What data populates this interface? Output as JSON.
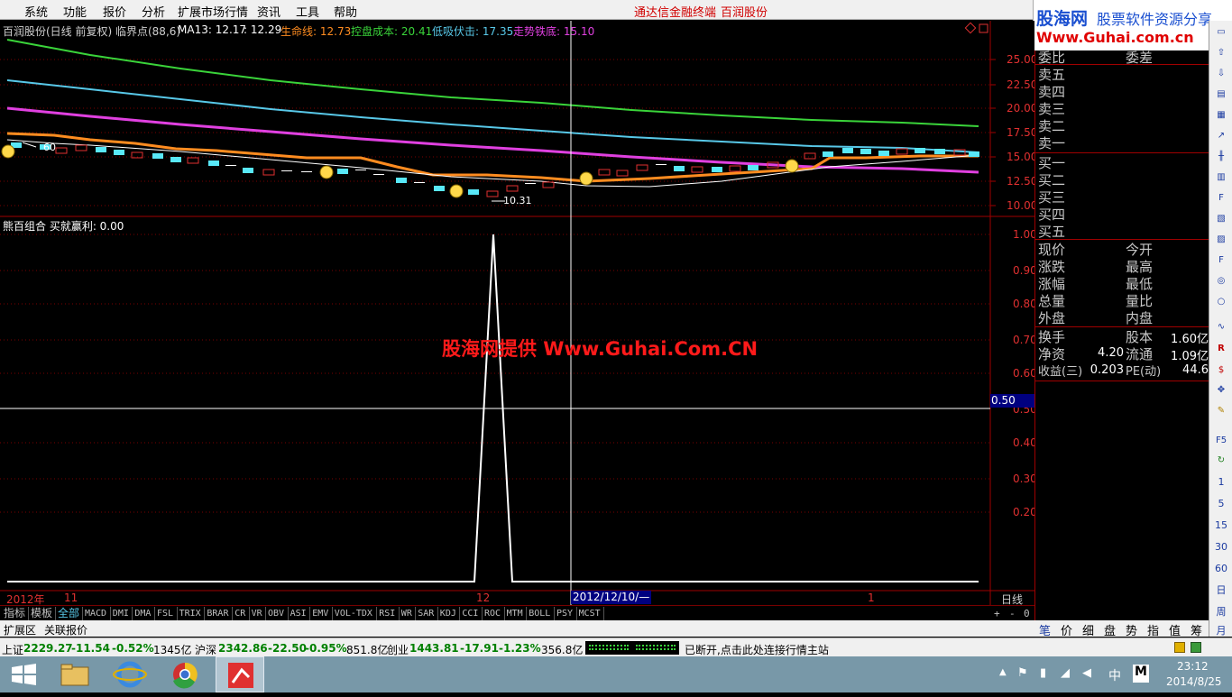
{
  "menu": {
    "items": [
      "系统",
      "功能",
      "报价",
      "分析",
      "扩展市场行情",
      "资讯",
      "工具",
      "帮助"
    ],
    "center_title": "通达信金融终端",
    "center_stock": "百润股份"
  },
  "logo": {
    "line1a": "股海网",
    "line1b": "股票软件资源分享",
    "line2": "Www.Guhai.com.cn"
  },
  "main_chart": {
    "title": "百润股份(日线 前复权) 临界点(88,6)",
    "ma13": "MA13: 12.17",
    "ma13b": ": 12.29",
    "l1": "生命线: 12.73",
    "l2": "控盘成本: 20.41",
    "l3": "低吸伏击: 17.35",
    "l4": "走势铁底: 15.10",
    "y_ticks": [
      "25.00",
      "22.50",
      "20.00",
      "17.50",
      "15.00",
      "12.50",
      "10.00"
    ],
    "high_label": "60",
    "low_label": "10.31",
    "colors": {
      "green": "#3ad43a",
      "cyan": "#58c8e8",
      "magenta": "#e040e0",
      "orange": "#ff8c20",
      "white": "#ffffff",
      "red": "#e03030"
    }
  },
  "sub_chart": {
    "title": "熊百组合  买就赢利: 0.00",
    "y_ticks": [
      "1.00",
      "0.90",
      "0.80",
      "0.70",
      "0.60",
      "0.50",
      "0.40",
      "0.30",
      "0.20"
    ],
    "cursor_value": "0.50",
    "watermark": "股海网提供 Www.Guhai.Com.CN"
  },
  "x_axis": {
    "labels": [
      "2012年",
      "11",
      "12",
      "1"
    ],
    "cursor_date": "2012/12/10/—",
    "period": "日线"
  },
  "indicator_tabs": [
    "指标",
    "模板",
    "全部",
    "MACD",
    "DMI",
    "DMA",
    "FSL",
    "TRIX",
    "BRAR",
    "CR",
    "VR",
    "OBV",
    "ASI",
    "EMV",
    "VOL-TDX",
    "RSI",
    "WR",
    "SAR",
    "KDJ",
    "CCI",
    "ROC",
    "MTM",
    "BOLL",
    "PSY",
    "MCST"
  ],
  "tab_buttons": [
    "+",
    "-",
    "0"
  ],
  "sub_tabs": [
    "扩展区",
    "关联报价"
  ],
  "panel": {
    "weibi": "委比",
    "weicha": "委差",
    "sells": [
      "卖五",
      "卖四",
      "卖三",
      "卖二",
      "卖一"
    ],
    "buys": [
      "买一",
      "买二",
      "买三",
      "买四",
      "买五"
    ],
    "quote_left": [
      "现价",
      "涨跌",
      "涨幅",
      "总量",
      "外盘"
    ],
    "quote_right": [
      "今开",
      "最高",
      "最低",
      "量比",
      "内盘"
    ],
    "f1": "换手",
    "f2": "股本",
    "f2v": "1.60亿",
    "f3": "净资",
    "f3v": "4.20",
    "f4": "流通",
    "f4v": "1.09亿",
    "f5": "收益(三)",
    "f5v": "0.203",
    "f6": "PE(动)",
    "f6v": "44.6"
  },
  "bottom_tabs": [
    "笔",
    "价",
    "细",
    "盘",
    "势",
    "指",
    "值",
    "筹"
  ],
  "toolbar_numbers": [
    "1",
    "5",
    "15",
    "30",
    "60",
    "日",
    "周",
    "月"
  ],
  "status": {
    "sh_name": "上证",
    "sh_val": "2229.27",
    "sh_chg": "-11.54",
    "sh_pct": "-0.52%",
    "sh_amt": "1345亿",
    "hs_name": "沪深",
    "hs_val": "2342.86",
    "hs_chg": "-22.50",
    "hs_pct": "-0.95%",
    "hs_amt": "851.8亿",
    "cy_name": "创业",
    "cy_val": "1443.81",
    "cy_chg": "-17.91",
    "cy_pct": "-1.23%",
    "cy_amt": "356.8亿",
    "msg": "已断开,点击此处连接行情主站"
  },
  "taskbar": {
    "time": "23:12",
    "date": "2014/8/25",
    "ime": "中",
    "lang": "M"
  }
}
